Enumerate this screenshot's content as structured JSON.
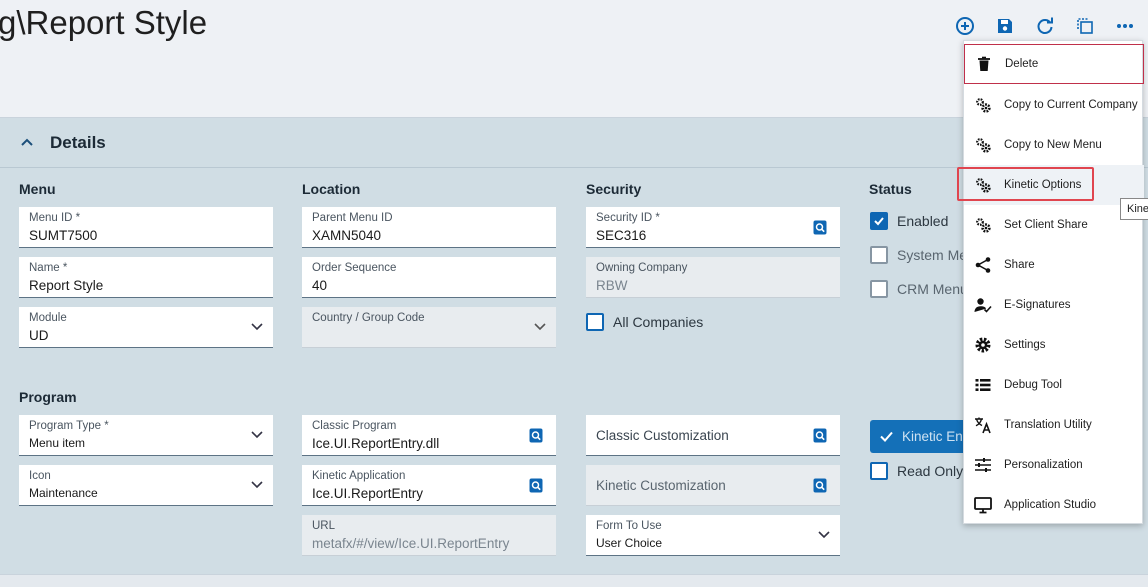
{
  "page": {
    "title": "g\\Report Style"
  },
  "toolbar": {
    "buttons": [
      {
        "name": "add",
        "icon": "plus-circle-icon"
      },
      {
        "name": "save",
        "icon": "save-icon"
      },
      {
        "name": "refresh",
        "icon": "refresh-icon"
      },
      {
        "name": "copy",
        "icon": "copy-icon"
      },
      {
        "name": "more",
        "icon": "ellipsis-icon"
      }
    ],
    "accent": "#0e66b3"
  },
  "details": {
    "title": "Details",
    "sections": {
      "menu": "Menu",
      "location": "Location",
      "security": "Security",
      "status": "Status",
      "program": "Program"
    },
    "fields": {
      "menu_id": {
        "label": "Menu ID *",
        "value": "SUMT7500"
      },
      "name": {
        "label": "Name *",
        "value": "Report Style"
      },
      "module": {
        "label": "Module",
        "value": "UD"
      },
      "parent_menu_id": {
        "label": "Parent Menu ID",
        "value": "XAMN5040"
      },
      "order_sequence": {
        "label": "Order Sequence",
        "value": "40"
      },
      "country_group_code": {
        "label": "Country / Group Code",
        "value": ""
      },
      "security_id": {
        "label": "Security ID *",
        "value": "SEC316"
      },
      "owning_company": {
        "label": "Owning Company",
        "value": "RBW"
      },
      "program_type": {
        "label": "Program Type *",
        "value": "Menu item"
      },
      "icon": {
        "label": "Icon",
        "value": "Maintenance"
      },
      "classic_program": {
        "label": "Classic Program",
        "value": "Ice.UI.ReportEntry.dll"
      },
      "kinetic_application": {
        "label": "Kinetic Application",
        "value": "Ice.UI.ReportEntry"
      },
      "url": {
        "label": "URL",
        "value": "metafx/#/view/Ice.UI.ReportEntry"
      },
      "classic_customization": {
        "placeholder": "Classic Customization"
      },
      "kinetic_customization": {
        "placeholder": "Kinetic Customization"
      },
      "form_to_use": {
        "label": "Form To Use",
        "value": "User Choice"
      }
    },
    "checkboxes": {
      "all_companies": {
        "label": "All Companies",
        "checked": false
      },
      "enabled": {
        "label": "Enabled",
        "checked": true
      },
      "system_menu": {
        "label": "System Men",
        "checked": false
      },
      "crm_menu": {
        "label": "CRM Menu",
        "checked": false
      },
      "read_only": {
        "label": "Read Only",
        "checked": false
      }
    },
    "kinetic_button": {
      "label": "Kinetic Ena"
    }
  },
  "overflow_menu": {
    "items": [
      {
        "label": "Delete",
        "icon": "trash-icon"
      },
      {
        "label": "Copy to Current Company",
        "icon": "gears-icon"
      },
      {
        "label": "Copy to New Menu",
        "icon": "gears-icon"
      },
      {
        "label": "Kinetic Options",
        "icon": "gears-icon"
      },
      {
        "label": "Set Client Share",
        "icon": "gears-icon"
      },
      {
        "label": "Share",
        "icon": "share-icon"
      },
      {
        "label": "E-Signatures",
        "icon": "user-check-icon"
      },
      {
        "label": "Settings",
        "icon": "gear-icon"
      },
      {
        "label": "Debug Tool",
        "icon": "list-icon"
      },
      {
        "label": "Translation Utility",
        "icon": "translate-icon"
      },
      {
        "label": "Personalization",
        "icon": "sliders-icon"
      },
      {
        "label": "Application Studio",
        "icon": "monitor-icon"
      }
    ]
  },
  "tooltip": {
    "text": "Kine"
  }
}
